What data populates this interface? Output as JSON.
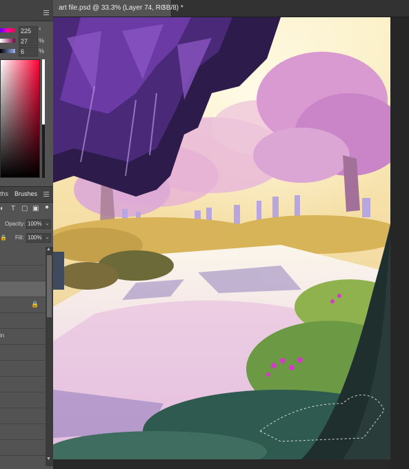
{
  "document": {
    "tab_title": "art file.psd @ 33.3% (Layer 74, RGB/8) *",
    "close_glyph": "×"
  },
  "color_panel": {
    "sliders": [
      {
        "value": "225",
        "unit": "°",
        "gradient": "linear-gradient(to right,#5a00ff,#ff00aa,#ff0040)"
      },
      {
        "value": "27",
        "unit": "%",
        "gradient": "linear-gradient(to right,#ffffff,#7a0044)"
      },
      {
        "value": "6",
        "unit": "%",
        "gradient": "linear-gradient(to right,#000000,#9ab2ff)"
      }
    ]
  },
  "panel_tabs": {
    "partial_tab": "ths",
    "brushes": "Brushes"
  },
  "layers_panel": {
    "opacity_label": "Opacity:",
    "opacity_value": "100%",
    "fill_label": "Fill:",
    "fill_value": "100%",
    "dropdown_glyph": "⌄",
    "partial_layer_text": "in"
  },
  "icons": {
    "menu": "hamburger-menu-icon",
    "type_tool": "T",
    "lock": "lock-icon",
    "close": "close-icon"
  },
  "colors": {
    "panel_bg": "#535353",
    "canvas_bg": "#282828",
    "selected_layer": "#676767"
  }
}
